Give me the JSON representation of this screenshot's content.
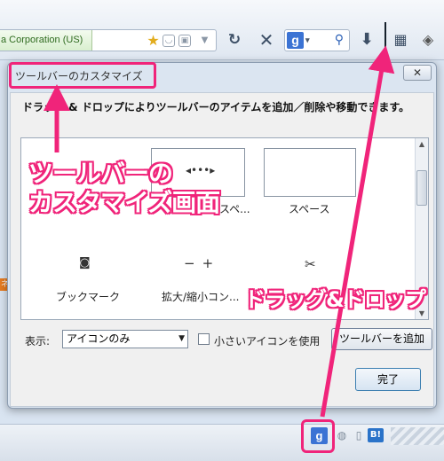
{
  "browser": {
    "identity": "a Corporation (US)",
    "search_engine_letter": "g",
    "status_engine_letter": "g",
    "hatena_label": "B!"
  },
  "dialog": {
    "title": "ツールバーのカスタマイズ",
    "close_label": "✕",
    "instruction": "ドラッグ & ドロップによりツールバーのアイテムを追加／削除や移動できます。",
    "palette_items": [
      {
        "label": "...",
        "icon": "folder-icon"
      },
      {
        "label": "可変長のスペ...",
        "icon": "flexible-space-icon"
      },
      {
        "label": "スペース",
        "icon": "space-icon"
      },
      {
        "label": "ブックマーク",
        "icon": "bookmark-icon"
      },
      {
        "label": "拡大/縮小コン...",
        "icon": "zoom-controls-icon"
      },
      {
        "label": "",
        "icon": "cut-icon"
      }
    ],
    "show_label": "表示:",
    "show_value": "アイコンのみ",
    "small_icons_label": "小さいアイコンを使用",
    "add_toolbar_label": "ツールバーを追加",
    "done_label": "完了"
  },
  "annotations": {
    "screen_label_line1": "ツールバーの",
    "screen_label_line2": "カスタマイズ画面",
    "drag_drop_label": "ドラッグ&ドロップ",
    "accent_color": "#f0247a"
  }
}
